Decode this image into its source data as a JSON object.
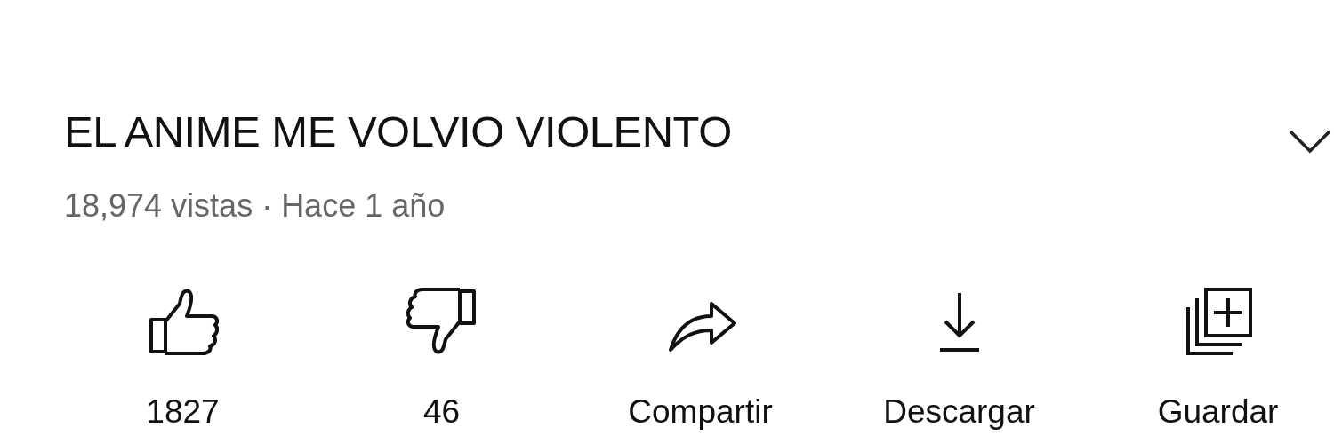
{
  "video": {
    "title": "EL ANIME ME VOLVIO VIOLENTO",
    "meta": "18,974 vistas · Hace 1 año",
    "expanded": false
  },
  "actions": [
    {
      "kind": "like",
      "label": "1827"
    },
    {
      "kind": "dislike",
      "label": "46"
    },
    {
      "kind": "share",
      "label": "Compartir"
    },
    {
      "kind": "download",
      "label": "Descargar"
    },
    {
      "kind": "save",
      "label": "Guardar"
    }
  ]
}
